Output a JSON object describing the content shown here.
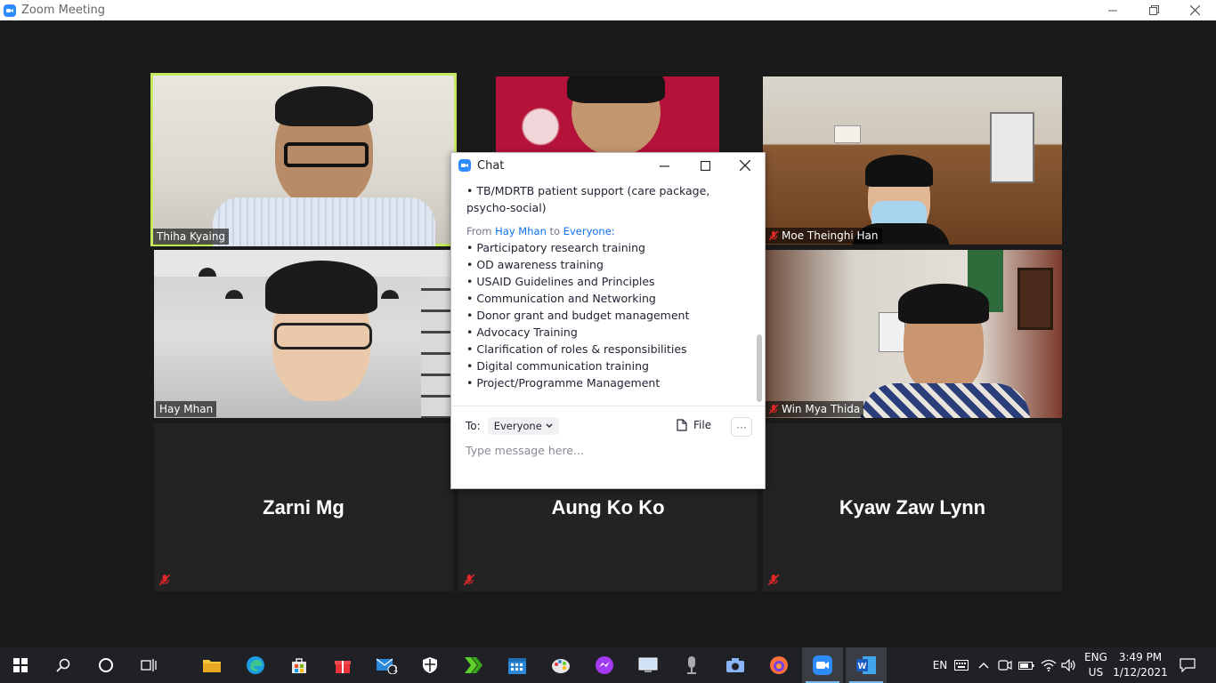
{
  "window": {
    "title": "Zoom Meeting",
    "controls": {
      "minimize": "—",
      "restore": "❐",
      "close": "✕"
    }
  },
  "participants": [
    {
      "name": "Thiha Kyaing",
      "video": true,
      "active_speaker": true,
      "muted": false
    },
    {
      "name": "",
      "video": true,
      "muted": false
    },
    {
      "name": "Moe Theinghi Han",
      "video": true,
      "muted": true
    },
    {
      "name": "Hay Mhan",
      "video": true,
      "muted": false
    },
    {
      "name": "Win Mya Thida",
      "video": true,
      "muted": true
    },
    {
      "name": "Zarni Mg",
      "video": false,
      "muted": true
    },
    {
      "name": "Aung Ko Ko",
      "video": false,
      "muted": true
    },
    {
      "name": "Kyaw Zaw Lynn",
      "video": false,
      "muted": true
    }
  ],
  "chat": {
    "title": "Chat",
    "messages_top": [
      "• TB/MDRTB patient support (care package,",
      "psycho-social)"
    ],
    "from_label": "From",
    "from_sender": "Hay Mhan",
    "to_label": "to",
    "to_recipient": "Everyone:",
    "messages": [
      "• Participatory research training",
      "• OD awareness training",
      "• USAID Guidelines and Principles",
      "• Communication and Networking",
      "• Donor grant and budget management",
      "• Advocacy Training",
      "• Clarification of roles & responsibilities",
      "• Digital communication training",
      "• Project/Programme Management"
    ],
    "to_prefix": "To:",
    "recipient_select": "Everyone",
    "file_label": "File",
    "more_label": "···",
    "input_placeholder": "Type message here..."
  },
  "taskbar": {
    "language_short": "EN",
    "language_top": "ENG",
    "language_bottom": "US",
    "time": "3:49 PM",
    "date": "1/12/2021",
    "mail_badge": "1"
  },
  "colors": {
    "active_speaker_border": "#c6e85c",
    "zoom_blue": "#2d8cff",
    "sender_link": "#0e71eb",
    "mute_red": "#e02828"
  }
}
